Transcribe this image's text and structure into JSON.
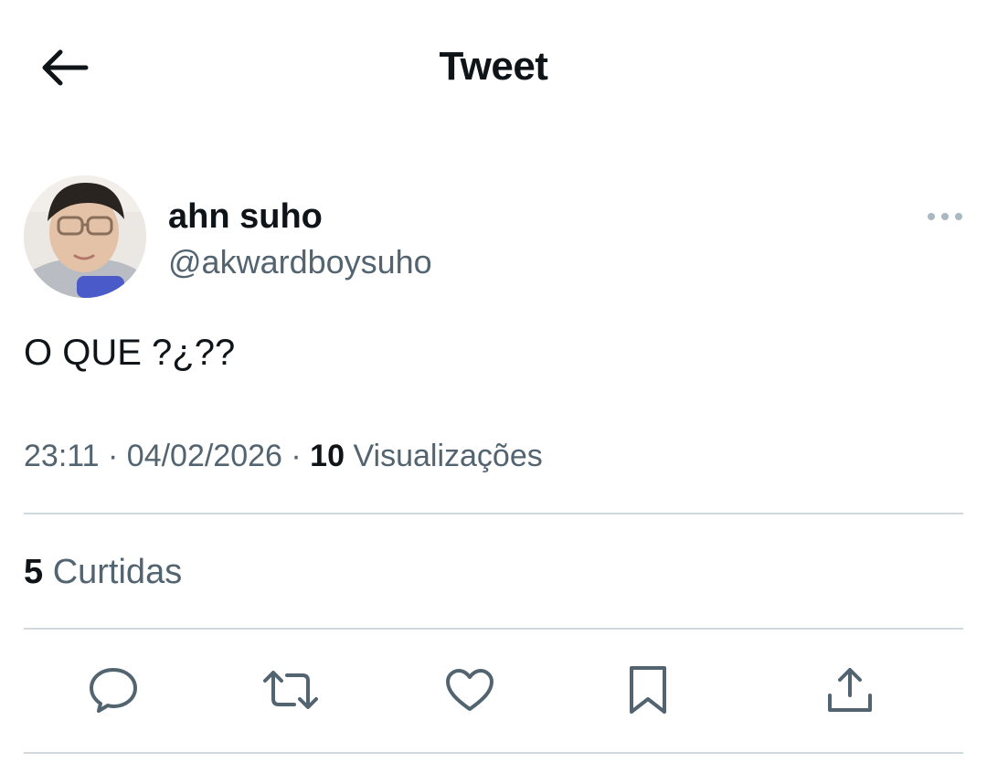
{
  "header": {
    "title": "Tweet",
    "back_icon": "arrow-left-icon"
  },
  "author": {
    "display_name": "ahn suho",
    "handle": "@akwardboysuho",
    "more_icon": "more-horizontal-icon"
  },
  "tweet": {
    "text": "O QUE ?¿??"
  },
  "meta": {
    "time": "23:11",
    "separator_1": " · ",
    "date": "04/02/2026",
    "separator_2": " · ",
    "views_count": "10",
    "views_label": "Visualizações"
  },
  "stats": {
    "likes_count": "5",
    "likes_label": "Curtidas"
  },
  "actions": [
    "reply-icon",
    "retweet-icon",
    "like-icon",
    "bookmark-icon",
    "share-icon"
  ],
  "colors": {
    "text_primary": "#0f1419",
    "text_secondary": "#536471",
    "divider": "#cfd9de",
    "icon": "#536471"
  }
}
